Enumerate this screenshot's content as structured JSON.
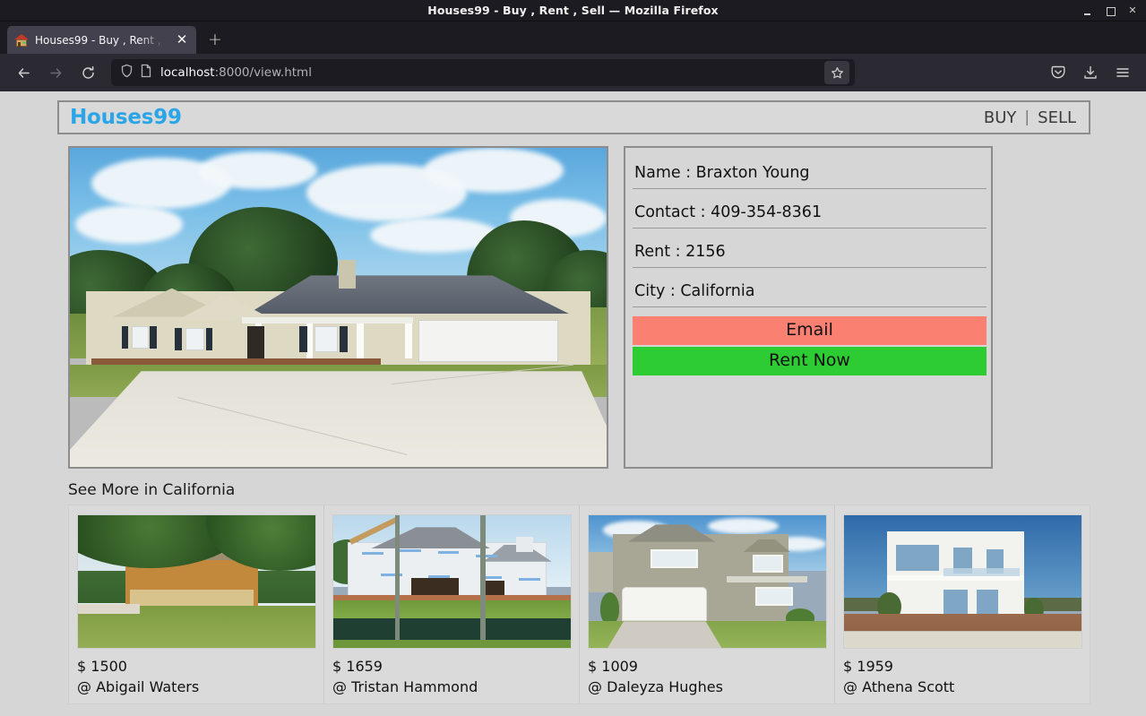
{
  "window": {
    "title": "Houses99 - Buy , Rent , Sell — Mozilla Firefox",
    "minimize_label": "Minimize",
    "maximize_label": "Restore",
    "close_label": "✕"
  },
  "browser": {
    "tab": {
      "title": "Houses99 - Buy , Rent , Sell",
      "favicon": "house-icon",
      "close_label": "✕"
    },
    "new_tab_label": "+",
    "back_icon": "back-arrow-icon",
    "forward_icon": "forward-arrow-icon",
    "reload_icon": "reload-icon",
    "url": {
      "host": "localhost",
      "path": ":8000/view.html",
      "shield_icon": "shield-icon",
      "page_icon": "page-icon"
    },
    "bookmark_icon": "star-icon",
    "pocket_icon": "pocket-icon",
    "downloads_icon": "download-icon",
    "menu_icon": "hamburger-menu-icon"
  },
  "site": {
    "brand": "Houses99",
    "nav": {
      "buy": "BUY",
      "separator": "|",
      "sell": "SELL"
    }
  },
  "listing": {
    "photo_alt": "featured-house-photo",
    "details": [
      {
        "label": "Name : Braxton Young"
      },
      {
        "label": "Contact : 409-354-8361"
      },
      {
        "label": "Rent : 2156"
      },
      {
        "label": "City : California"
      }
    ],
    "email_button": "Email",
    "rent_button": "Rent Now",
    "email_color": "#fa8072",
    "rent_color": "#2ecc33"
  },
  "see_more": {
    "heading": "See More in California",
    "cards": [
      {
        "price": "$ 1500",
        "owner": "@ Abigail Waters"
      },
      {
        "price": "$ 1659",
        "owner": "@ Tristan Hammond"
      },
      {
        "price": "$ 1009",
        "owner": "@ Daleyza Hughes"
      },
      {
        "price": "$ 1959",
        "owner": "@ Athena Scott"
      }
    ]
  },
  "colors": {
    "brand": "#2aa5e8",
    "page_background": "#d6d6d6",
    "frame_border": "#8d8d8d"
  }
}
